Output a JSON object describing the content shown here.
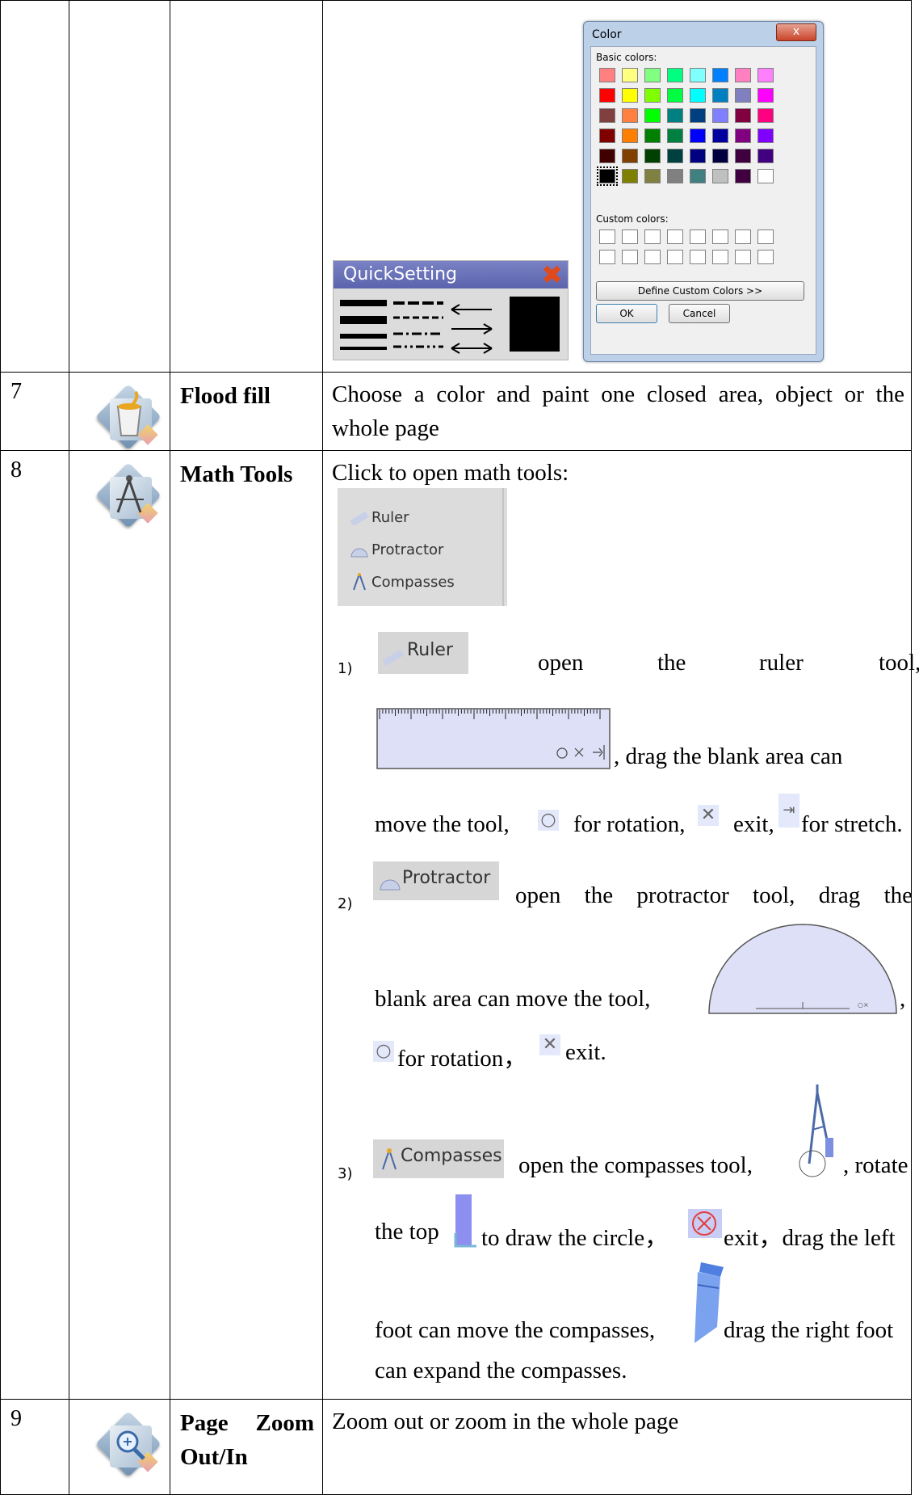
{
  "quick_setting": {
    "title": "QuickSetting"
  },
  "color_dialog": {
    "title": "Color",
    "close": "x",
    "basic_colors_label": "Basic colors:",
    "custom_colors_label": "Custom colors:",
    "define_button": "Define Custom Colors >>",
    "ok_button": "OK",
    "cancel_button": "Cancel",
    "basic_colors": [
      "#ff8080",
      "#ffff80",
      "#80ff80",
      "#00ff80",
      "#80ffff",
      "#0080ff",
      "#ff80c0",
      "#ff80ff",
      "#ff0000",
      "#ffff00",
      "#80ff00",
      "#00ff40",
      "#00ffff",
      "#0080c0",
      "#8080c0",
      "#ff00ff",
      "#804040",
      "#ff8040",
      "#00ff00",
      "#008080",
      "#004080",
      "#8080ff",
      "#800040",
      "#ff0080",
      "#800000",
      "#ff8000",
      "#008000",
      "#008040",
      "#0000ff",
      "#0000a0",
      "#800080",
      "#8000ff",
      "#400000",
      "#804000",
      "#004000",
      "#004040",
      "#000080",
      "#000040",
      "#400040",
      "#400080",
      "#000000",
      "#808000",
      "#808040",
      "#808080",
      "#408080",
      "#c0c0c0",
      "#400040",
      "#ffffff"
    ],
    "selected_index": 40
  },
  "rows": [
    {
      "number": "7",
      "icon": "paint-bucket-icon",
      "name": "Flood fill",
      "description": "Choose a color and paint one closed area, object or the whole page"
    },
    {
      "number": "8",
      "icon": "compasses-tool-icon",
      "name": "Math Tools",
      "intro": "Click to open math tools:",
      "menu": [
        "Ruler",
        "Protractor",
        "Compasses"
      ],
      "ruler": {
        "index": "1)",
        "chip": "Ruler",
        "line1": [
          "open",
          "the",
          "ruler",
          "tool,"
        ],
        "line2": ", drag the blank area can",
        "line3a": "move the tool,",
        "line3b": "for rotation,",
        "line3c": "exit,",
        "line3d": "for stretch."
      },
      "protractor": {
        "index": "2)",
        "chip": "Protractor",
        "line1": "open the protractor tool, drag the",
        "line2": "blank area can move the tool,",
        "line2end": ",",
        "line3a": "for rotation，",
        "line3b": "exit."
      },
      "compasses": {
        "index": "3)",
        "chip": "Compasses",
        "line1a": "open the compasses tool,",
        "line1b": ", rotate",
        "line2a": "the top",
        "line2b": "to draw the circle，",
        "line2c": "exit，drag the left",
        "line3a": "foot can move the compasses,",
        "line3b": "drag the right foot",
        "line4": "can expand the compasses."
      }
    },
    {
      "number": "9",
      "icon": "zoom-icon",
      "name": "Page Zoom Out/In",
      "description": "Zoom out or zoom in the whole page"
    }
  ]
}
